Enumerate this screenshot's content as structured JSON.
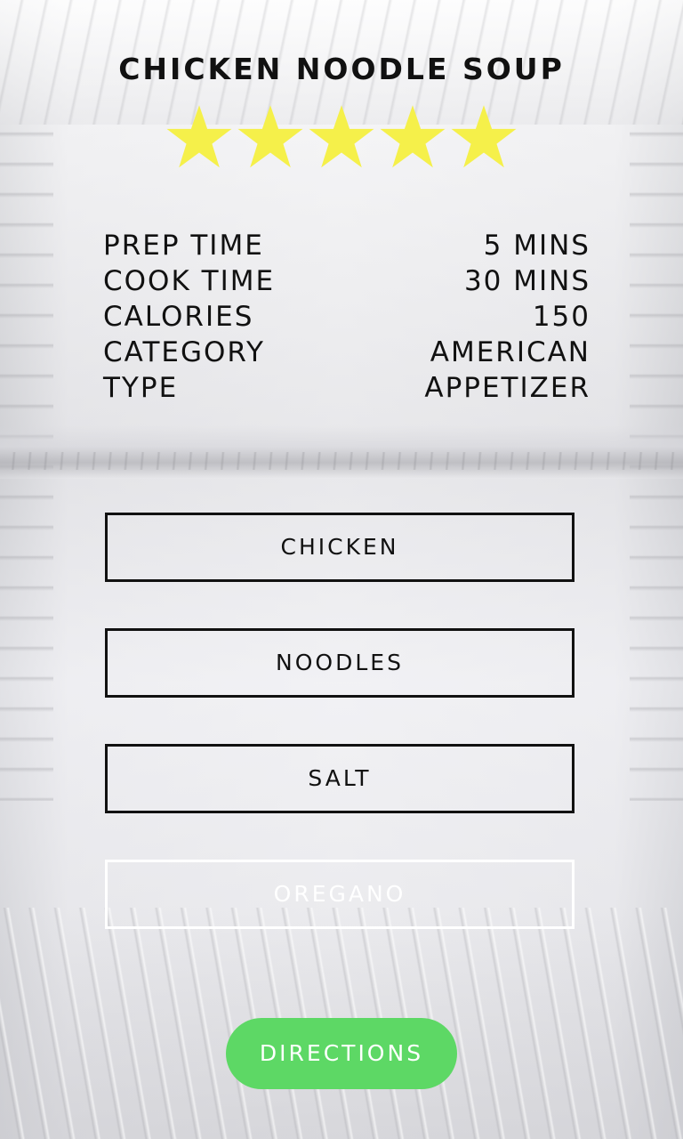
{
  "recipe": {
    "title": "CHICKEN NOODLE SOUP",
    "rating": {
      "value": 5,
      "max": 5
    },
    "star_color": "#F5F04A"
  },
  "info": [
    {
      "label": "PREP TIME",
      "value": "5 MINS"
    },
    {
      "label": "COOK TIME",
      "value": "30 MINS"
    },
    {
      "label": "CALORIES",
      "value": "150"
    },
    {
      "label": "CATEGORY",
      "value": "AMERICAN"
    },
    {
      "label": "TYPE",
      "value": "APPETIZER"
    }
  ],
  "ingredients": [
    {
      "label": "CHICKEN"
    },
    {
      "label": "NOODLES"
    },
    {
      "label": "SALT"
    },
    {
      "label": "OREGANO"
    }
  ],
  "directions_button": {
    "label": "DIRECTIONS",
    "color": "#5DD865"
  }
}
